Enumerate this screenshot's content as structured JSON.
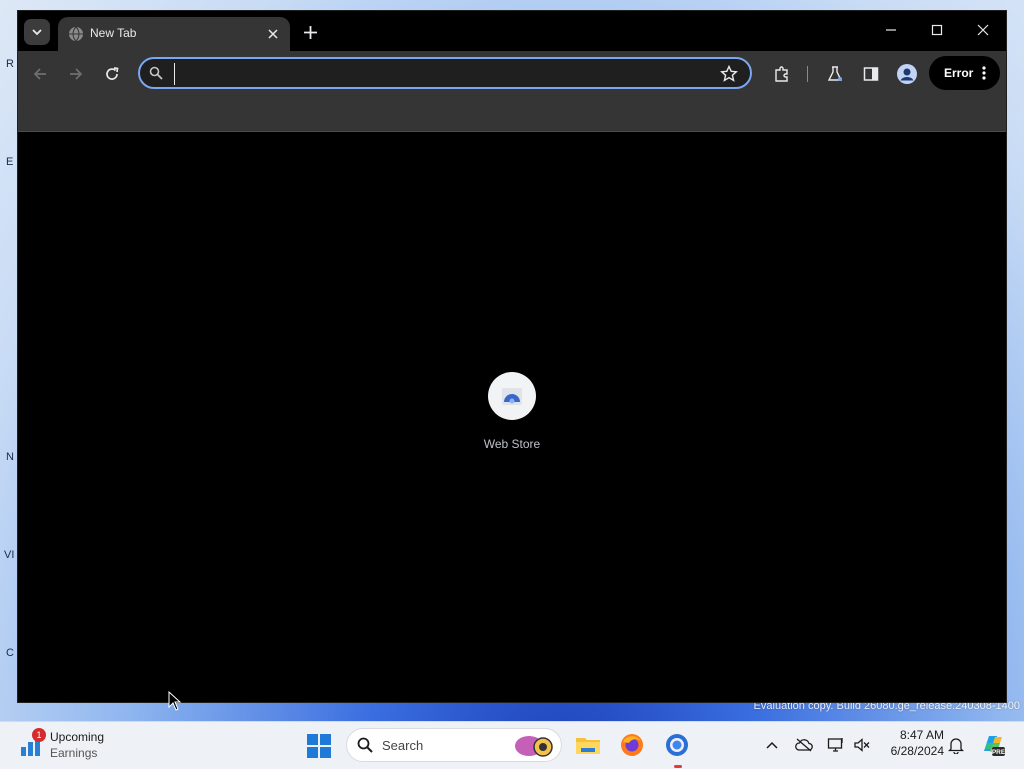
{
  "desktop": {
    "watermark": "Evaluation copy. Build 26080.ge_release.240308-1400",
    "left_edge_glyphs": [
      "R",
      "E",
      "N",
      "VI",
      "C"
    ]
  },
  "browser": {
    "tab": {
      "title": "New Tab"
    },
    "omnibox": {
      "value": "",
      "placeholder": ""
    },
    "profile_chip": {
      "label": "Error"
    },
    "shortcut": {
      "label": "Web Store"
    }
  },
  "taskbar": {
    "widget": {
      "badge": "1",
      "title": "Upcoming",
      "subtitle": "Earnings"
    },
    "search": {
      "label": "Search"
    },
    "clock": {
      "time": "8:47 AM",
      "date": "6/28/2024"
    }
  },
  "colors": {
    "omnibox_focus": "#7aa6f2",
    "toolbar_bg": "#353535",
    "content_bg": "#000000",
    "taskbar_bg": "#eef1f6"
  }
}
